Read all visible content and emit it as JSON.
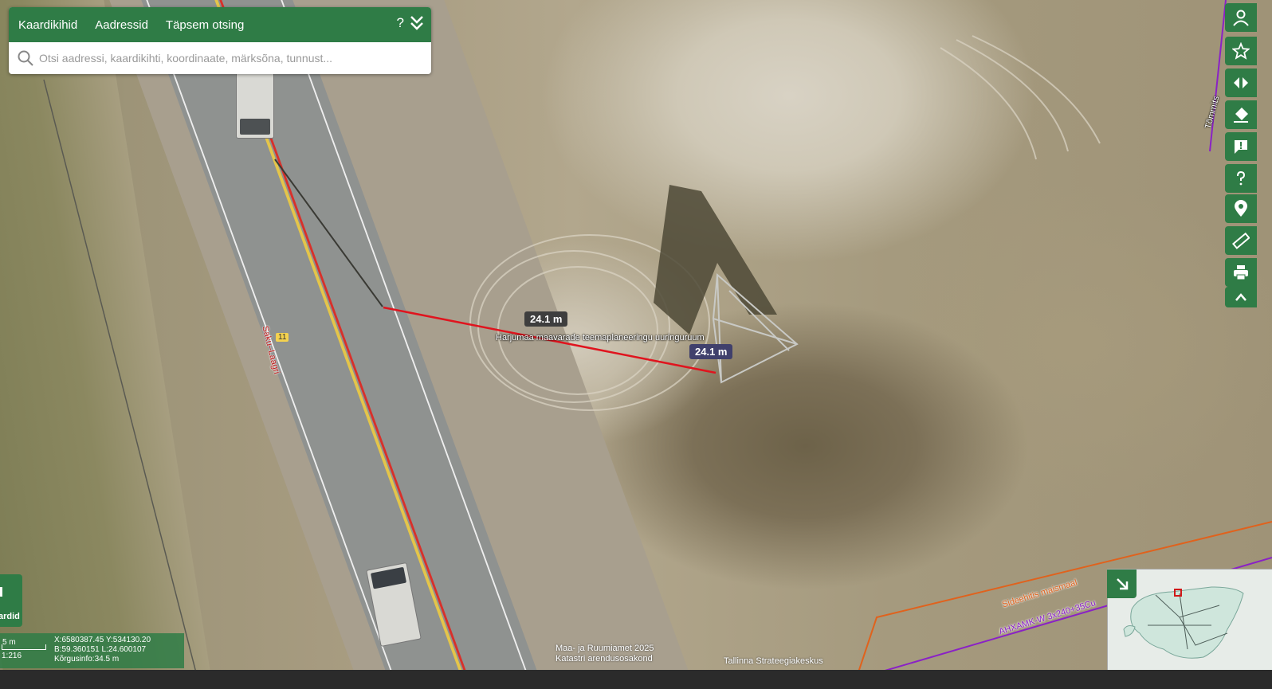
{
  "topbar": {
    "tabs": [
      "Kaardikihid",
      "Aadressid",
      "Täpsem otsing"
    ],
    "help_label": "?",
    "search_placeholder": "Otsi aadressi, kaardikihti, koordinaate, märksõna, tunnust..."
  },
  "map": {
    "measure_label_1": "24.1 m",
    "measure_label_2": "24.1 m",
    "zone_label": "Harjumaa maavarade teemaplaneeringu uuringuruum",
    "road_name": "Saku–Laagri",
    "road_number": "11",
    "place_label": "Tõmmits",
    "cable_label_1": "Sideehitis maismaal",
    "cable_label_2": "AHXAMK-W 3x240+35Cu",
    "attribution_1": "Maa- ja Ruumiamet 2025",
    "attribution_2": "Katastri arendusosakond",
    "attribution_3": "Tallinna Strateegiakeskus"
  },
  "left_panel": {
    "legend_label": "ardid"
  },
  "scale": {
    "bar_label": "5 m",
    "ratio": "1:216",
    "xy": "X:6580387.45 Y:534130.20",
    "bl": "B:59.360151 L:24.600107",
    "height": "Kõrgusinfo:34.5 m"
  },
  "toolbar": {
    "icons": [
      "user-icon",
      "star-icon",
      "compare-icon",
      "eraser-icon",
      "feedback-icon",
      "help-icon",
      "location-icon",
      "ruler-icon",
      "print-icon",
      "collapse-icon"
    ]
  },
  "colors": {
    "brand_green": "#2f7c46",
    "measure_line": "#e0141e",
    "cable_orange": "#e0621d",
    "cable_purple": "#8a21c6"
  }
}
